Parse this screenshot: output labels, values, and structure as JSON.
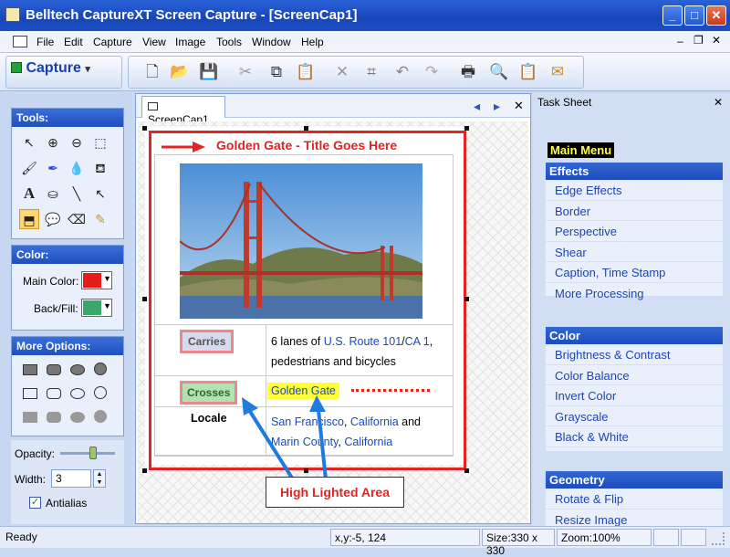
{
  "window": {
    "title": "Belltech CaptureXT Screen Capture - [ScreenCap1]",
    "min": "_",
    "max": "□",
    "close": "✕"
  },
  "menu": [
    "File",
    "Edit",
    "Capture",
    "View",
    "Image",
    "Tools",
    "Window",
    "Help"
  ],
  "toolbar": {
    "capture_label": "Capture",
    "capture_arrow": "▾"
  },
  "tools_panel": {
    "title": "Tools:"
  },
  "color_panel": {
    "title": "Color:",
    "main_label": "Main Color:",
    "main_color": "#e81b1b",
    "back_label": "Back/Fill:",
    "back_color": "#3aa86b"
  },
  "options_panel": {
    "title": "More Options:"
  },
  "opacity": {
    "label": "Opacity:",
    "level": 0.6
  },
  "width": {
    "label": "Width:",
    "value": "3"
  },
  "antialias": {
    "label": "Antialias",
    "checked": true
  },
  "document": {
    "tab_label": "ScreenCap1",
    "nav_prev": "◂",
    "nav_next": "▸",
    "close": "✕",
    "heading": "Golden Gate - Title Goes Here",
    "rows": [
      {
        "label": "Carries",
        "value_parts": [
          "6 lanes of ",
          "U.S. Route 101",
          "/",
          "CA 1",
          ",",
          "pedestrians and bicycles"
        ]
      },
      {
        "label": "Crosses",
        "value": "Golden Gate"
      },
      {
        "label": "Locale",
        "value_parts": [
          "San Francisco",
          ", ",
          "California",
          " and",
          "Marin County",
          ", ",
          "California"
        ]
      }
    ],
    "callout": "High Lighted Area"
  },
  "task_sheet": {
    "title": "Task Sheet",
    "close": "✕",
    "main_menu": "Main Menu",
    "sections": [
      {
        "title": "Effects",
        "items": [
          "Edge Effects",
          "Border",
          "Perspective",
          "Shear",
          "Caption, Time Stamp",
          "More Processing"
        ]
      },
      {
        "title": "Color",
        "items": [
          "Brightness & Contrast",
          "Color Balance",
          "Invert Color",
          "Grayscale",
          "Black & White"
        ]
      },
      {
        "title": "Geometry",
        "items": [
          "Rotate & Flip",
          "Resize Image"
        ]
      }
    ]
  },
  "status": {
    "ready": "Ready",
    "coords": "x,y:-5, 124",
    "size": "Size:330 x 330",
    "zoom": "Zoom:100%"
  },
  "colors": {
    "highlight_red": "#e32424",
    "link_blue": "#1a48c2",
    "yellow_highlight": "#ffff33",
    "arrow_blue": "#1e7be0"
  }
}
